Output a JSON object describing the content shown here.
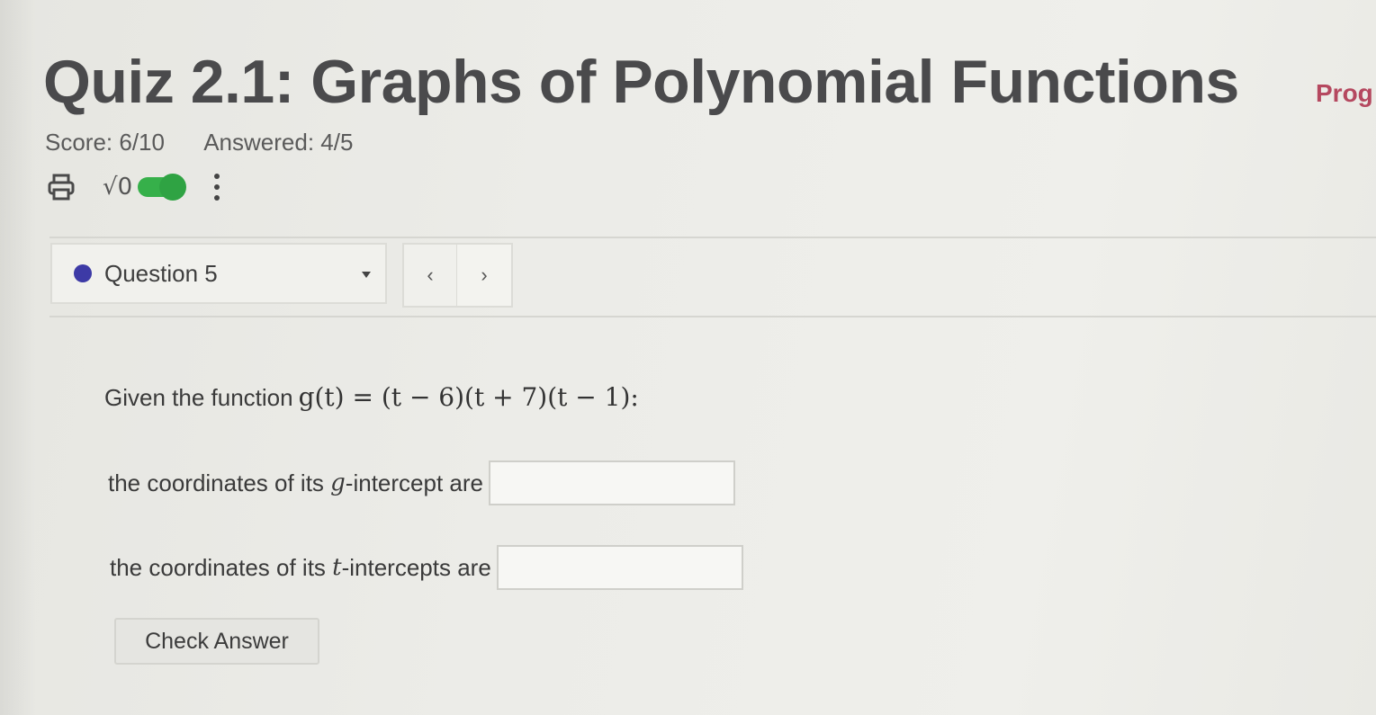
{
  "quiz": {
    "title": "Quiz 2.1: Graphs of Polynomial Functions",
    "progress_link": "Prog",
    "score": "Score: 6/10",
    "answered": "Answered: 4/5"
  },
  "toolbar": {
    "icons": [
      "printer-icon",
      "sqrt-math-icon",
      "toggle-switch",
      "more-vertical-icon"
    ],
    "math_symbol": "√0",
    "toggle_on": true
  },
  "navigation": {
    "question_label": "Question 5",
    "prev_glyph": "‹",
    "next_glyph": "›"
  },
  "question": {
    "intro": "Given the function",
    "function": "g(t) = (t − 6)(t + 7)(t − 1):",
    "line1_before": "the coordinates of its ",
    "line1_var": "g",
    "line1_after": "-intercept are",
    "line2_before": "the coordinates of its ",
    "line2_var": "t",
    "line2_after": "-intercepts are",
    "answer1_value": "",
    "answer2_value": ""
  },
  "actions": {
    "check_answer": "Check Answer"
  },
  "colors": {
    "progress_link": "#b5485f",
    "question_dot": "#3d3aa6",
    "toggle_green": "#36b04a"
  }
}
